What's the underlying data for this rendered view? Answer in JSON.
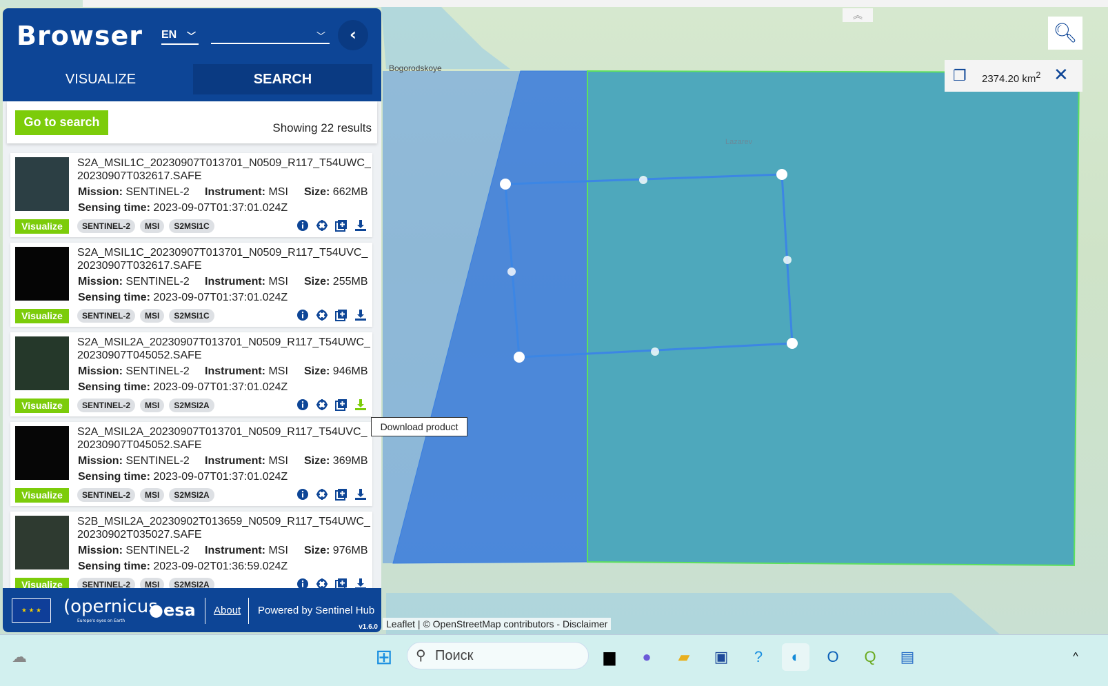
{
  "header": {
    "title": "Browser",
    "language": "EN",
    "theme_value": "",
    "back_icon": "chevron-left-icon"
  },
  "tabs": [
    {
      "label": "VISUALIZE"
    },
    {
      "label": "SEARCH"
    }
  ],
  "search_bar": {
    "go_to_search": "Go to search",
    "results_text": "Showing 22 results"
  },
  "labels": {
    "mission": "Mission:",
    "instrument": "Instrument:",
    "size": "Size:",
    "sensing": "Sensing time:",
    "visualize": "Visualize"
  },
  "results": [
    {
      "name": "S2A_MSIL1C_20230907T013701_N0509_R117_T54UWC_20230907T032617.SAFE",
      "mission": "SENTINEL-2",
      "instrument": "MSI",
      "size": "662MB",
      "sensing_time": "2023-09-07T01:37:01.024Z",
      "tags": [
        "SENTINEL-2",
        "MSI",
        "S2MSI1C"
      ],
      "thumb": "#2c3f44"
    },
    {
      "name": "S2A_MSIL1C_20230907T013701_N0509_R117_T54UVC_20230907T032617.SAFE",
      "mission": "SENTINEL-2",
      "instrument": "MSI",
      "size": "255MB",
      "sensing_time": "2023-09-07T01:37:01.024Z",
      "tags": [
        "SENTINEL-2",
        "MSI",
        "S2MSI1C"
      ],
      "thumb": "#050505"
    },
    {
      "name": "S2A_MSIL2A_20230907T013701_N0509_R117_T54UWC_20230907T045052.SAFE",
      "mission": "SENTINEL-2",
      "instrument": "MSI",
      "size": "946MB",
      "sensing_time": "2023-09-07T01:37:01.024Z",
      "tags": [
        "SENTINEL-2",
        "MSI",
        "S2MSI2A"
      ],
      "thumb": "#25382a"
    },
    {
      "name": "S2A_MSIL2A_20230907T013701_N0509_R117_T54UVC_20230907T045052.SAFE",
      "mission": "SENTINEL-2",
      "instrument": "MSI",
      "size": "369MB",
      "sensing_time": "2023-09-07T01:37:01.024Z",
      "tags": [
        "SENTINEL-2",
        "MSI",
        "S2MSI2A"
      ],
      "thumb": "#060606"
    },
    {
      "name": "S2B_MSIL2A_20230902T013659_N0509_R117_T54UWC_20230902T035027.SAFE",
      "mission": "SENTINEL-2",
      "instrument": "MSI",
      "size": "976MB",
      "sensing_time": "2023-09-02T01:36:59.024Z",
      "tags": [
        "SENTINEL-2",
        "MSI",
        "S2MSI2A"
      ],
      "thumb": "#2e3a30"
    }
  ],
  "footer": {
    "about": "About",
    "powered": "Powered by Sentinel Hub",
    "version": "v1.6.0",
    "logos": [
      "European Union",
      "Copernicus Europe's eyes on Earth",
      "esa"
    ]
  },
  "map": {
    "place_label": "Bogorodskoye",
    "place_label2": "Lazarev",
    "attribution": "Leaflet | © OpenStreetMap contributors - Disclaimer",
    "area_value": "2374.20 km",
    "area_unit_sup": "2",
    "tooltip": "Download product"
  },
  "taskbar": {
    "search_placeholder": "Поиск"
  },
  "colors": {
    "brand": "#0d4596",
    "accent_green": "#7ccc0a"
  }
}
